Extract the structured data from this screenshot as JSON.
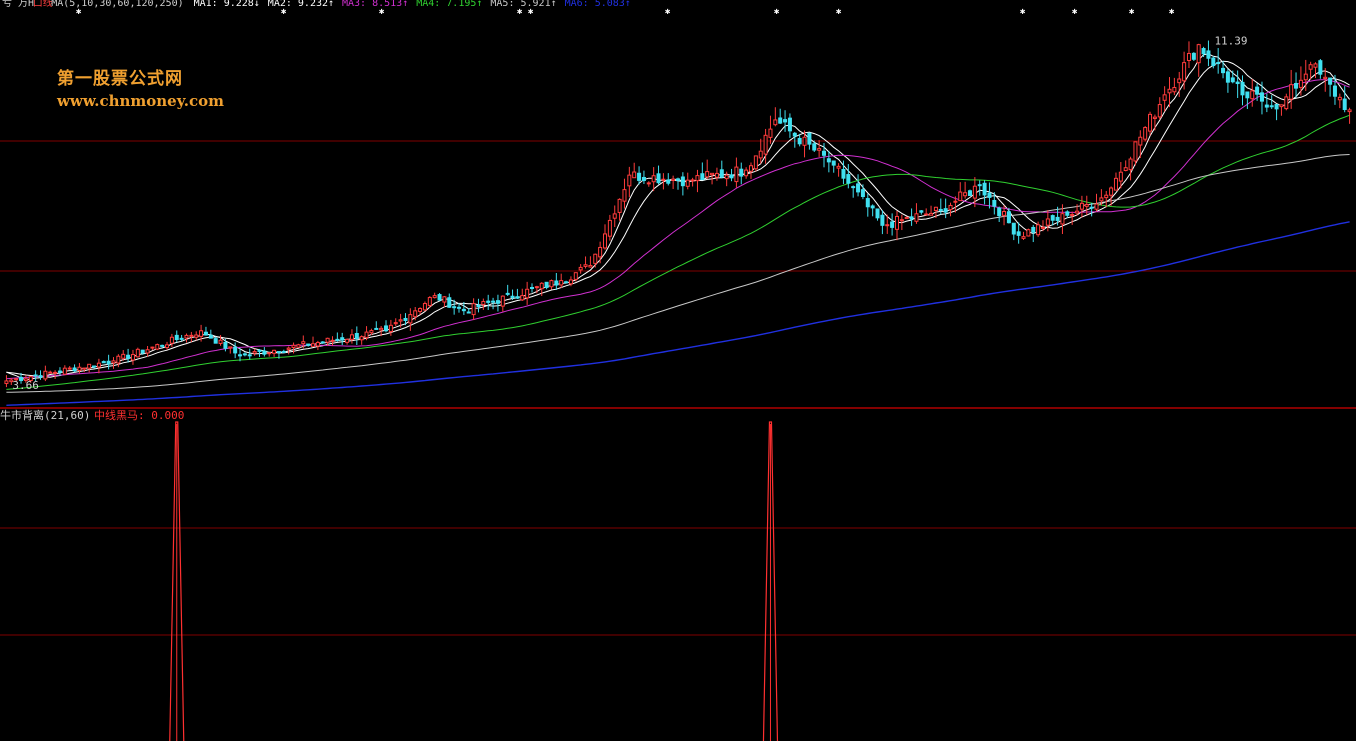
{
  "main_panel": {
    "header": {
      "prefix": "亏 万H",
      "line_type": "口线",
      "ma_params": "MA(5,10,30,60,120,250)",
      "ma1": "MA1: 9.228↓",
      "ma2": "MA2: 9.232↑",
      "ma3": "MA3: 8.513↑",
      "ma4": "MA4: 7.195↑",
      "ma5": "MA5: 5.921↑",
      "ma6": "MA6: 5.083↑"
    },
    "high_label": "11.39",
    "low_label": "3.66"
  },
  "watermark": {
    "title": "第一股票公式网",
    "url": "www.chnmoney.com"
  },
  "indicator_panel": {
    "name": "牛市背离(21,60)",
    "series_label": "中线黑马: 0.000"
  },
  "colors": {
    "background": "#000000",
    "candle_up": "#ff3c3c",
    "candle_down": "#40e0f0",
    "grid": "#800000",
    "ma5": "#ffffff",
    "ma10": "#ffffff",
    "ma30": "#d030d0",
    "ma60": "#30d030",
    "ma120": "#c8c8c8",
    "ma250": "#2030e0",
    "indicator": "#ff3030",
    "watermark": "#f0a030"
  },
  "chart_data": {
    "type": "candlestick",
    "y_range": [
      3.66,
      11.39
    ],
    "candle_count": 225,
    "segments": [
      {
        "bars": 0,
        "close": 4.0
      },
      {
        "bars": 22,
        "close": 4.4
      },
      {
        "bars": 18,
        "close": 5.0
      },
      {
        "bars": 8,
        "close": 4.5
      },
      {
        "bars": 30,
        "close": 5.0
      },
      {
        "bars": 10,
        "close": 5.7
      },
      {
        "bars": 6,
        "close": 5.4
      },
      {
        "bars": 20,
        "close": 6.0
      },
      {
        "bars": 6,
        "close": 6.3
      },
      {
        "bars": 8,
        "close": 8.1
      },
      {
        "bars": 12,
        "close": 8.0
      },
      {
        "bars": 12,
        "close": 8.2
      },
      {
        "bars": 6,
        "close": 9.2
      },
      {
        "bars": 12,
        "close": 8.3
      },
      {
        "bars": 10,
        "close": 7.1
      },
      {
        "bars": 12,
        "close": 7.4
      },
      {
        "bars": 8,
        "close": 7.9
      },
      {
        "bars": 8,
        "close": 6.9
      },
      {
        "bars": 10,
        "close": 7.3
      },
      {
        "bars": 8,
        "close": 7.7
      },
      {
        "bars": 12,
        "close": 9.7
      },
      {
        "bars": 7,
        "close": 10.7
      },
      {
        "bars": 9,
        "close": 9.7
      },
      {
        "bars": 8,
        "close": 9.5
      },
      {
        "bars": 6,
        "close": 10.3
      },
      {
        "bars": 8,
        "close": 9.4
      }
    ],
    "moving_averages": [
      {
        "name": "MA1",
        "period": 5
      },
      {
        "name": "MA2",
        "period": 10
      },
      {
        "name": "MA3",
        "period": 30
      },
      {
        "name": "MA4",
        "period": 60
      },
      {
        "name": "MA5",
        "period": 120
      },
      {
        "name": "MA6",
        "period": 250
      }
    ],
    "indicator": {
      "name": "中线黑马",
      "value": 0.0,
      "spikes_at_candle": [
        35,
        157
      ]
    }
  }
}
